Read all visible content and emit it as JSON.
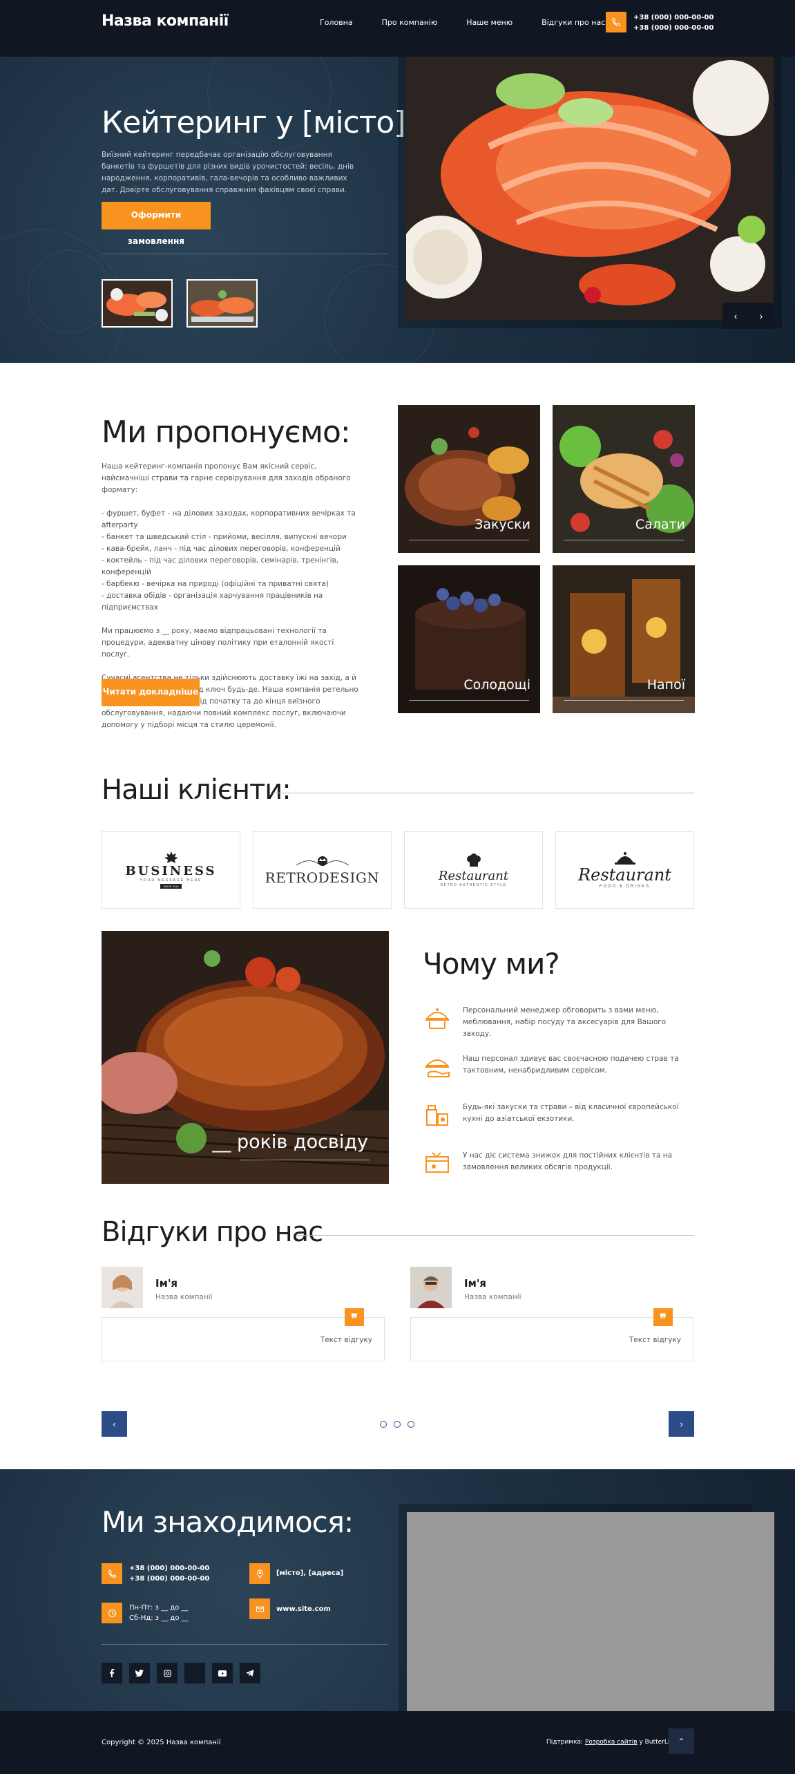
{
  "header": {
    "logo": "Назва компанії",
    "nav": [
      "Головна",
      "Про компанію",
      "Наше меню",
      "Відгуки про нас"
    ],
    "phone1": "+38 (000) 000-00-00",
    "phone2": "+38 (000) 000-00-00"
  },
  "hero": {
    "title": "Кейтеринг у [місто]",
    "text": "Виїзний кейтеринг передбачає організацію обслуговування банкетів та фуршетів для різних видів урочистостей: весіль, днів народження, корпоративів, гала-вечорів та особливо важливих дат. Довірте обслуговування справжнім фахівцям своєї справи.",
    "button": "Оформити замовлення",
    "prev": "‹",
    "next": "›"
  },
  "offer": {
    "title": "Ми пропонуємо:",
    "p1": "Наша кейтеринг-компанія пропонує Вам якісний сервіс, найсмачніші страви та гарне сервірування для заходів обраного формату:",
    "list": [
      "- фуршет, буфет - на ділових заходах, корпоративних вечірках та afterparty",
      "- банкет та шведський стіл - прийоми, весілля, випускні вечори",
      "- кава-брейк, ланч - під час ділових переговорів, конференцій",
      "- коктейль - під час ділових переговорів, семінарів, тренінгів, конференцій",
      "- барбекю - вечірка на природі (офіційні та приватні свята)",
      "- доставка обідів - організація харчування працівників на підприємствах"
    ],
    "p2": "Ми працюємо з __ року, маємо відпрацьовані технології та процедури, адекватну цінову політику при еталонній якості послуг.",
    "p3": "Сучасні агентства не тільки здійснюють доставку їжі на захід, а й повністю готують його під ключ будь-де. Наша компанія ретельно опрацьовує всі дрібниці від початку та до кінця виїзного обслуговування, надаючи повний комплекс послуг, включаючи допомогу у підборі місця та стилю церемонії.",
    "button": "Читати докладніше",
    "cards": [
      "Закуски",
      "Салати",
      "Солодощі",
      "Напої"
    ]
  },
  "clients": {
    "title": "Наші клієнти:",
    "logos": [
      {
        "name": "BUSINESS",
        "sub": "YOUR MESSAGE HERE",
        "tag": "SINCE 2016"
      },
      {
        "name": "RETRODESIGN",
        "sub": "",
        "tag": ""
      },
      {
        "name": "Restaurant",
        "sub": "RETRO AUTHENTIC STYLE",
        "tag": ""
      },
      {
        "name": "Restaurant",
        "sub": "FOOD & DRINKS",
        "tag": ""
      }
    ]
  },
  "why": {
    "title": "Чому ми?",
    "years": "__ років досвіду",
    "items": [
      "Персональний менеджер обговорить з вами меню, меблювання, набір посуду та аксесуарів для Вашого заходу.",
      "Наш персонал здивує вас своєчасною подачею страв та тактовним, ненабридливим сервісом.",
      "Будь-які закуски та страви – від класичної європейської кухні до азіатської екзотики.",
      "У нас діє система знижок для постійних клієнтів та на замовлення великих обсягів продукції."
    ]
  },
  "reviews": {
    "title": "Відгуки про нас",
    "items": [
      {
        "name": "Ім'я",
        "company": "Назва компанії",
        "text": "Текст відгуку"
      },
      {
        "name": "Ім'я",
        "company": "Назва компанії",
        "text": "Текст відгуку"
      }
    ],
    "prev": "‹",
    "next": "›",
    "quote": "❞"
  },
  "contacts": {
    "title": "Ми знаходимося:",
    "phone1": "+38 (000) 000-00-00",
    "phone2": "+38 (000) 000-00-00",
    "address": "[місто], [адреса]",
    "hours1": "Пн-Пт: з __ до __",
    "hours2": "Сб-Нд: з __ до __",
    "site": "www.site.com"
  },
  "footer": {
    "copyright": "Copyright © 2025 Назва компанії",
    "dev_prefix": "Підтримка: ",
    "dev_link": "Розробка сайтів",
    "dev_suffix": " у ButterLife",
    "up": "⌃"
  },
  "colors": {
    "accent": "#f7931e",
    "dark": "#101722",
    "navy": "#2c4c87"
  }
}
